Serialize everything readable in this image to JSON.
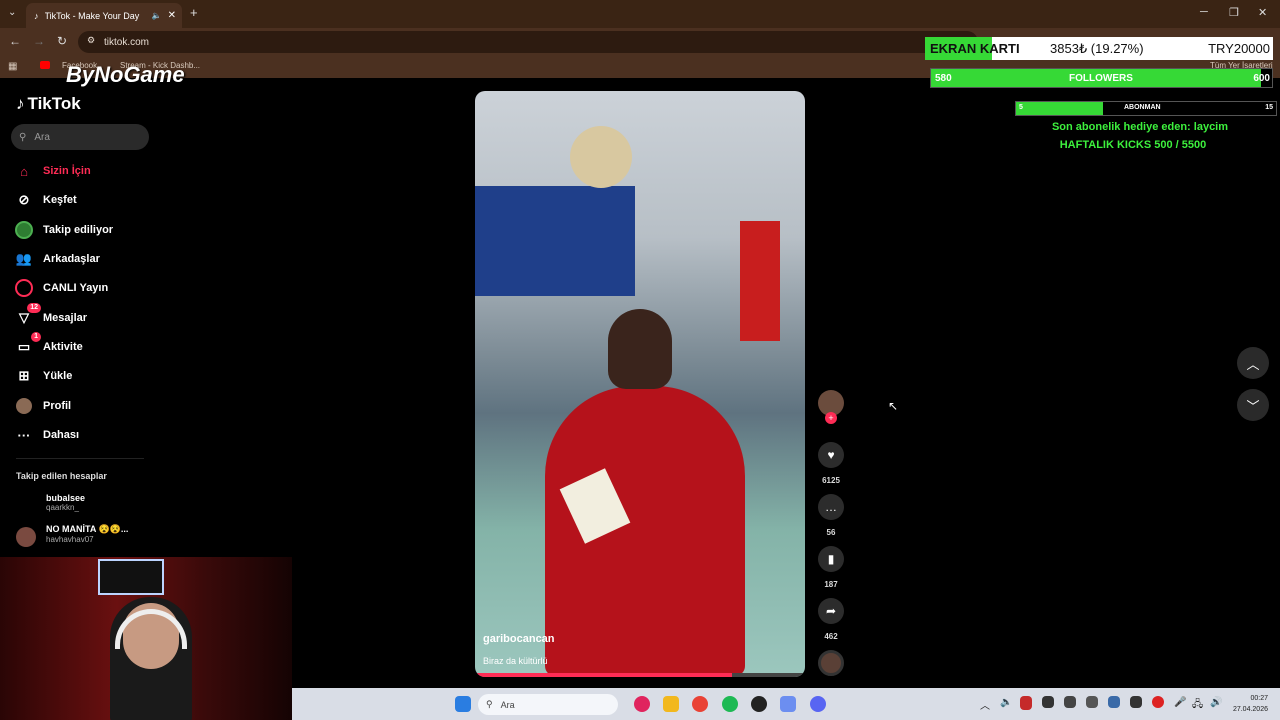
{
  "browser": {
    "tab_title": "TikTok - Make Your Day",
    "url": "tiktok.com",
    "bookmarks": [
      "Facebook",
      "Stream - Kick Dashb..."
    ],
    "bookmarks_right": "Tüm Yer İşaretleri"
  },
  "watermark": "ByNoGame",
  "sidebar": {
    "logo": "TikTok",
    "search_placeholder": "Ara",
    "items": [
      {
        "label": "Sizin İçin",
        "icon": "home-icon",
        "active": true
      },
      {
        "label": "Keşfet",
        "icon": "compass-icon"
      },
      {
        "label": "Takip ediliyor",
        "icon": "following-avatar-icon"
      },
      {
        "label": "Arkadaşlar",
        "icon": "friends-icon"
      },
      {
        "label": "CANLI Yayın",
        "icon": "live-icon"
      },
      {
        "label": "Mesajlar",
        "icon": "messages-icon",
        "badge": "12"
      },
      {
        "label": "Aktivite",
        "icon": "activity-icon",
        "badge": "1"
      },
      {
        "label": "Yükle",
        "icon": "upload-icon"
      },
      {
        "label": "Profil",
        "icon": "profile-avatar-icon"
      },
      {
        "label": "Dahası",
        "icon": "more-icon"
      }
    ],
    "following_header": "Takip edilen hesaplar",
    "following": [
      {
        "name": "bubalsee",
        "handle": "qaarkkn_"
      },
      {
        "name": "NO MANİTA 😵😵...",
        "handle": "havhavhav07"
      }
    ]
  },
  "video": {
    "username": "garibocancan",
    "caption": "Biraz da kültürlü",
    "progress": 0.78
  },
  "actions": {
    "likes": "6125",
    "comments": "56",
    "saves": "187",
    "shares": "462"
  },
  "overlay": {
    "ekran_label": "EKRAN KARTI",
    "ekran_value": "3853₺ (19.27%)",
    "ekran_goal": "TRY20000",
    "ekran_fraction": 0.1927,
    "followers_label": "FOLLOWERS",
    "followers_current": "580",
    "followers_goal": "600",
    "followers_fraction": 0.967,
    "abonman_label": "ABONMAN",
    "abonman_current": "5",
    "abonman_goal": "15",
    "abonman_fraction": 0.333,
    "sub_gift_text": "Son abonelik hediye eden: laycim",
    "weekly_kicks": "HAFTALIK KICKS 500 / 5500"
  },
  "taskbar": {
    "search_placeholder": "Ara",
    "time": "00:27",
    "date": "27.04.2026"
  },
  "colors": {
    "accent": "#fe2c55",
    "overlay_green": "#3df03d"
  }
}
